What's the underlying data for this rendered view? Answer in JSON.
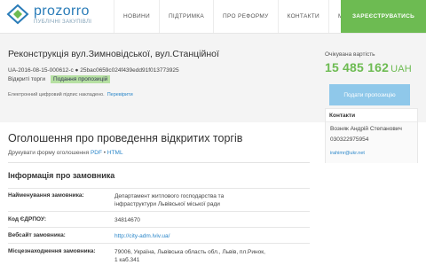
{
  "header": {
    "logo_text": "prozorro",
    "logo_sub": "ПУБЛІЧНІ ЗАКУПІВЛІ",
    "nav": [
      "НОВИНИ",
      "ПІДТРИМКА",
      "ПРО РЕФОРМУ",
      "КОНТАКТИ",
      "МОНІТОРИНГ"
    ],
    "register_label": "ЗАРЕЄСТРУВАТИСЬ"
  },
  "tender": {
    "title": "Реконструкція вул.Зимновідської, вул.Станційної",
    "id_line": "UA-2016-08-15-000612-c ● 25bac0659c024f439edd91f013773925",
    "status": "Відкриті торги",
    "status_badge": "Подання пропозицій",
    "signature_text": "Електронний цифровий підпис накладено.",
    "signature_link": "Перевірити"
  },
  "price": {
    "label": "Очікувана вартість",
    "value": "15 485 162",
    "currency": "UAH"
  },
  "sidebar": {
    "apply_label": "Подати пропозицію",
    "contacts_title": "Контакти",
    "name": "Возняк Андрій Степанович",
    "phone": "030322975954",
    "email": "irahimr@ukr.net"
  },
  "announcement": {
    "title": "Оголошення про проведення відкритих торгів",
    "print_prefix": "Друкувати форму оголошення",
    "pdf": "PDF",
    "separator": "•",
    "html": "HTML"
  },
  "customer": {
    "section_title": "Інформація про замовника",
    "rows": [
      {
        "label": "Найменування замовника:",
        "value": "Департамент житлового господарства та інфраструктури Львівської міської ради"
      },
      {
        "label": "Код ЄДРПОУ:",
        "value": "34814670"
      },
      {
        "label": "Вебсайт замовника:",
        "value": "http://city-adm.lviv.ua/"
      },
      {
        "label": "Місцезнаходження замовника:",
        "value": "79006, Україна, Львівська область обл., Львів, пл.Ринок, 1 каб.341"
      }
    ]
  }
}
